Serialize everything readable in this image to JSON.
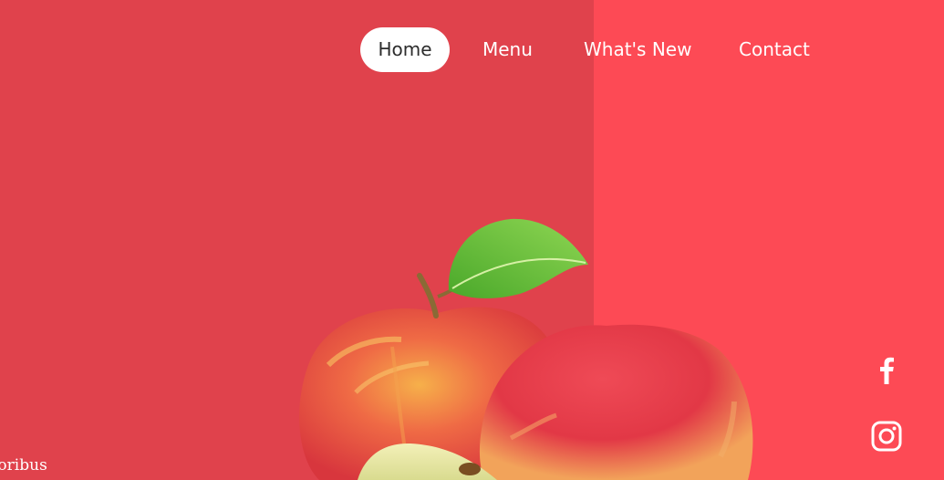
{
  "nav": {
    "items": [
      {
        "label": "Home",
        "active": true
      },
      {
        "label": "Menu",
        "active": false
      },
      {
        "label": "What's New",
        "active": false
      },
      {
        "label": "Contact",
        "active": false
      }
    ]
  },
  "social": {
    "icons": [
      "facebook-icon",
      "instagram-icon"
    ]
  },
  "hero": {
    "image": "apples-with-leaf-and-slice"
  },
  "footer_fragment": "loribus",
  "colors": {
    "panel_left": "#e0424c",
    "panel_right": "#fd4a55",
    "nav_active_bg": "#ffffff",
    "nav_active_text": "#2d2d2d",
    "nav_text": "#ffffff"
  }
}
